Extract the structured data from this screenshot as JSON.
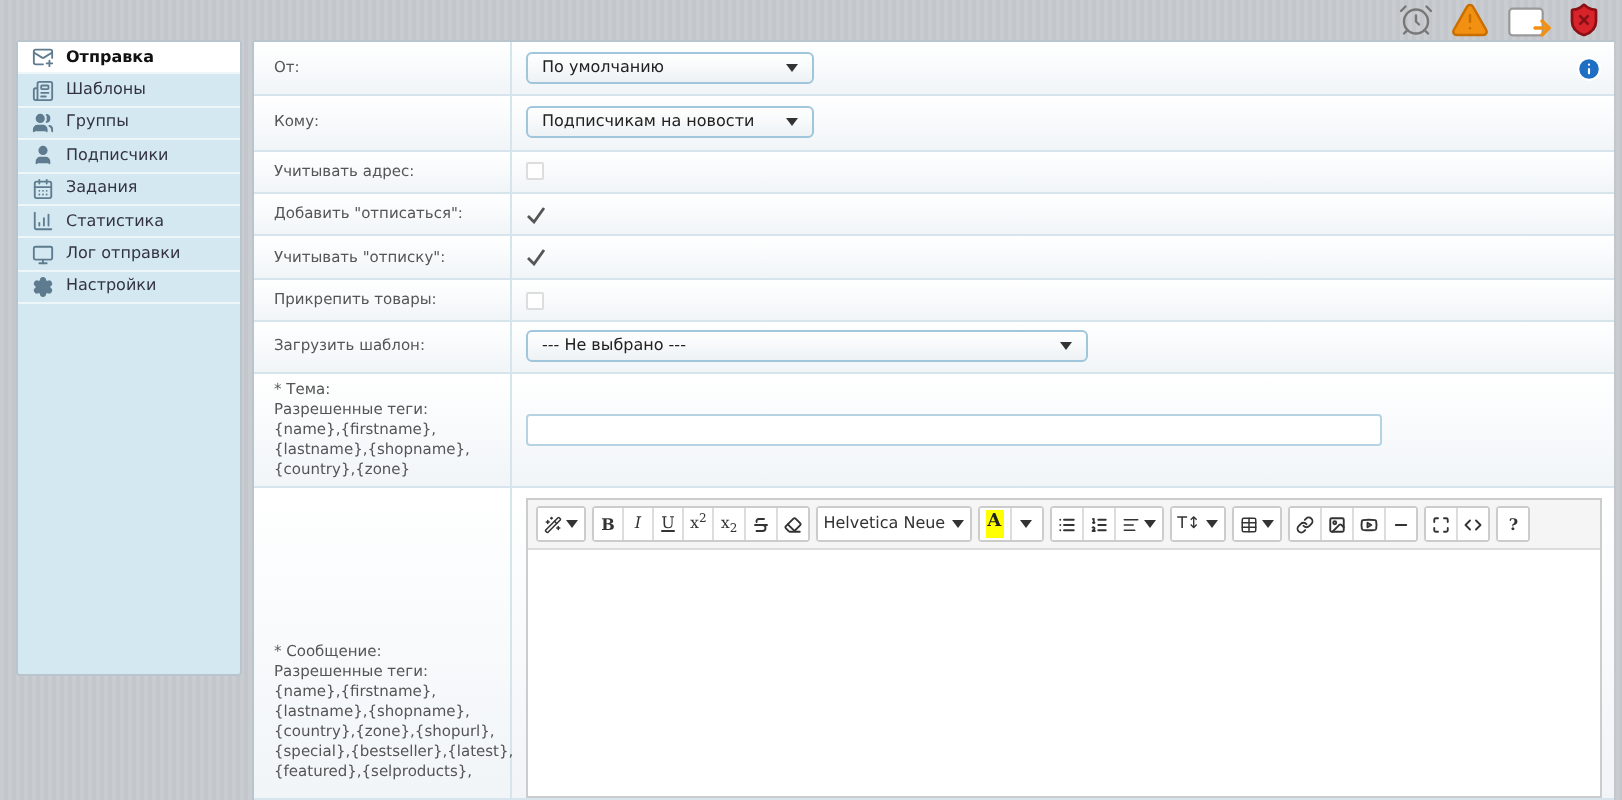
{
  "sidebar": {
    "items": [
      {
        "label": "Отправка",
        "selected": true
      },
      {
        "label": "Шаблоны",
        "selected": false
      },
      {
        "label": "Группы",
        "selected": false
      },
      {
        "label": "Подписчики",
        "selected": false
      },
      {
        "label": "Задания",
        "selected": false
      },
      {
        "label": "Статистика",
        "selected": false
      },
      {
        "label": "Лог отправки",
        "selected": false
      },
      {
        "label": "Настройки",
        "selected": false
      }
    ]
  },
  "form": {
    "rows": [
      {
        "kind": "select",
        "label": "От:",
        "value": "По умолчанию"
      },
      {
        "kind": "select",
        "label": "Кому:",
        "value": "Подписчикам на новости"
      },
      {
        "kind": "checkbox",
        "label": "Учитывать адрес:",
        "checked": false
      },
      {
        "kind": "checkbox",
        "label": "Добавить \"отписаться\":",
        "checked": true
      },
      {
        "kind": "checkbox",
        "label": "Учитывать \"отписку\":",
        "checked": true
      },
      {
        "kind": "checkbox",
        "label": "Прикрепить товары:",
        "checked": false
      },
      {
        "kind": "select",
        "label": "Загрузить шаблон:",
        "value": "--- Не выбрано ---"
      },
      {
        "kind": "input",
        "label": "* Тема:\nРазрешенные теги:\n{name},{firstname},\n{lastname},{shopname},\n{country},{zone}"
      },
      {
        "kind": "editor",
        "label": "* Сообщение:\nРазрешенные теги:\n{name},{firstname},\n{lastname},{shopname},\n{country},{zone},{shopurl},\n{special},{bestseller},{latest},\n{featured},{selproducts},"
      }
    ]
  },
  "editor_toolbar": [
    [
      {
        "kind": "magic"
      }
    ],
    [
      {
        "kind": "bold",
        "label": "B"
      },
      {
        "kind": "italic",
        "label": "I"
      },
      {
        "kind": "underline",
        "label": "U"
      },
      {
        "kind": "plain",
        "label": "x$^{2}$"
      },
      {
        "kind": "plain",
        "label": "x$_{2}$"
      },
      {
        "kind": "strike"
      },
      {
        "kind": "eraser"
      }
    ],
    [
      {
        "kind": "dropdown",
        "label": "Helvetica Neue"
      }
    ],
    [
      {
        "kind": "highlight",
        "label": "A"
      },
      {
        "kind": "caret"
      }
    ],
    [
      {
        "kind": "bullets"
      },
      {
        "kind": "numbers"
      },
      {
        "kind": "align"
      }
    ],
    [
      {
        "kind": "dropdown",
        "label": "T↕"
      }
    ],
    [
      {
        "kind": "table"
      }
    ],
    [
      {
        "kind": "link"
      },
      {
        "kind": "image"
      },
      {
        "kind": "video"
      },
      {
        "kind": "rule"
      }
    ],
    [
      {
        "kind": "fullscreen"
      },
      {
        "kind": "code"
      }
    ],
    [
      {
        "kind": "bold",
        "label": "?"
      }
    ]
  ]
}
